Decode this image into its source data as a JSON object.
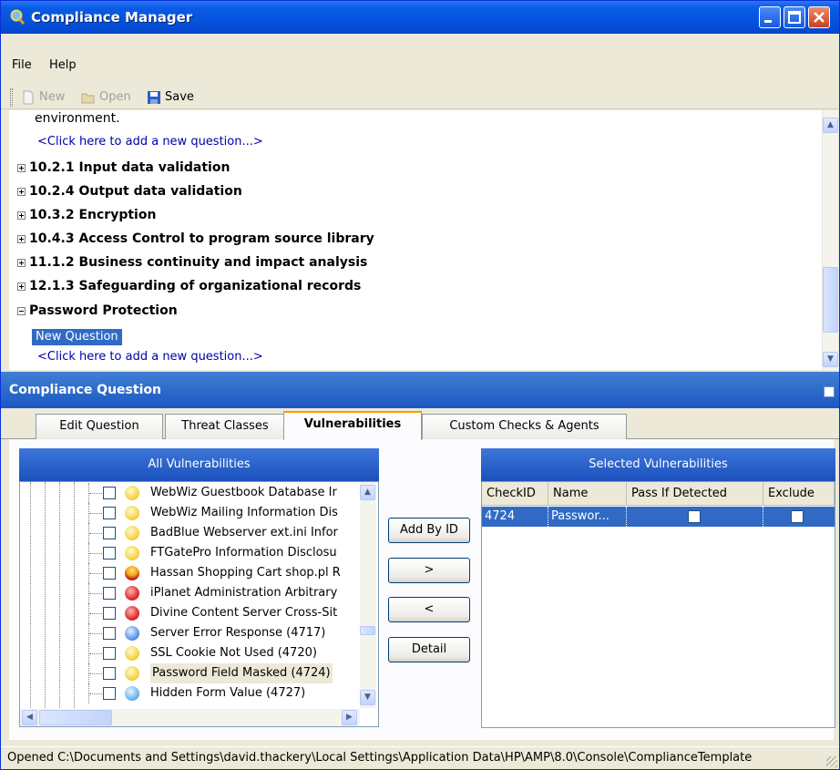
{
  "window": {
    "title": "Compliance Manager",
    "icon": "magnifier-icon"
  },
  "menu": {
    "items": [
      "File",
      "Help"
    ]
  },
  "toolbar": {
    "new_label": "New",
    "open_label": "Open",
    "save_label": "Save"
  },
  "tree": {
    "rows": [
      {
        "kind": "text",
        "text": "environment."
      },
      {
        "kind": "link",
        "text": "<Click here to add a new question...>"
      },
      {
        "kind": "section",
        "expanded": false,
        "text": "10.2.1 Input data validation"
      },
      {
        "kind": "section",
        "expanded": false,
        "text": "10.2.4 Output data validation"
      },
      {
        "kind": "section",
        "expanded": false,
        "text": "10.3.2 Encryption"
      },
      {
        "kind": "section",
        "expanded": false,
        "text": "10.4.3 Access Control to program source library"
      },
      {
        "kind": "section",
        "expanded": false,
        "text": "11.1.2 Business continuity and impact analysis"
      },
      {
        "kind": "section",
        "expanded": false,
        "text": "12.1.3 Safeguarding of organizational records"
      },
      {
        "kind": "section",
        "expanded": true,
        "text": "Password Protection"
      },
      {
        "kind": "selected",
        "text": "New Question"
      },
      {
        "kind": "link",
        "text": "<Click here to add a new question...>"
      }
    ]
  },
  "panel": {
    "title": "Compliance Question"
  },
  "tabs": [
    {
      "label": "Edit Question",
      "active": false
    },
    {
      "label": "Threat Classes",
      "active": false
    },
    {
      "label": "Vulnerabilities",
      "active": true
    },
    {
      "label": "Custom Checks & Agents",
      "active": false
    }
  ],
  "all_vulnerabilities": {
    "title": "All Vulnerabilities",
    "items": [
      {
        "label": "WebWiz Guestbook Database Ir",
        "severity": "yellow"
      },
      {
        "label": "WebWiz Mailing Information Dis",
        "severity": "yellow"
      },
      {
        "label": "BadBlue Webserver ext.ini Infor",
        "severity": "yellow"
      },
      {
        "label": "FTGatePro Information Disclosu",
        "severity": "yellow"
      },
      {
        "label": "Hassan Shopping Cart shop.pl R",
        "severity": "critical"
      },
      {
        "label": "iPlanet Administration Arbitrary",
        "severity": "red"
      },
      {
        "label": "Divine Content Server Cross-Sit",
        "severity": "red"
      },
      {
        "label": "Server Error Response (4717)",
        "severity": "blue"
      },
      {
        "label": "SSL Cookie Not Used (4720)",
        "severity": "yellow"
      },
      {
        "label": "Password Field Masked (4724)",
        "severity": "yellow"
      },
      {
        "label": "Hidden Form Value (4727)",
        "severity": "info"
      }
    ]
  },
  "actions": {
    "add_by_id": "Add By ID",
    "add": ">",
    "remove": "<",
    "detail": "Detail"
  },
  "selected_vulnerabilities": {
    "title": "Selected Vulnerabilities",
    "columns": [
      "CheckID",
      "Name",
      "Pass If Detected",
      "Exclude"
    ],
    "rows": [
      {
        "check_id": "4724",
        "name": "Passwor...",
        "pass_if_detected": false,
        "exclude": false
      }
    ]
  },
  "status": {
    "text": "Opened C:\\Documents and Settings\\david.thackery\\Local Settings\\Application Data\\HP\\AMP\\8.0\\Console\\ComplianceTemplate"
  },
  "colors": {
    "accent": "#316ac5",
    "title_bar": "#0553df",
    "panel_header": "#2a63c8"
  }
}
